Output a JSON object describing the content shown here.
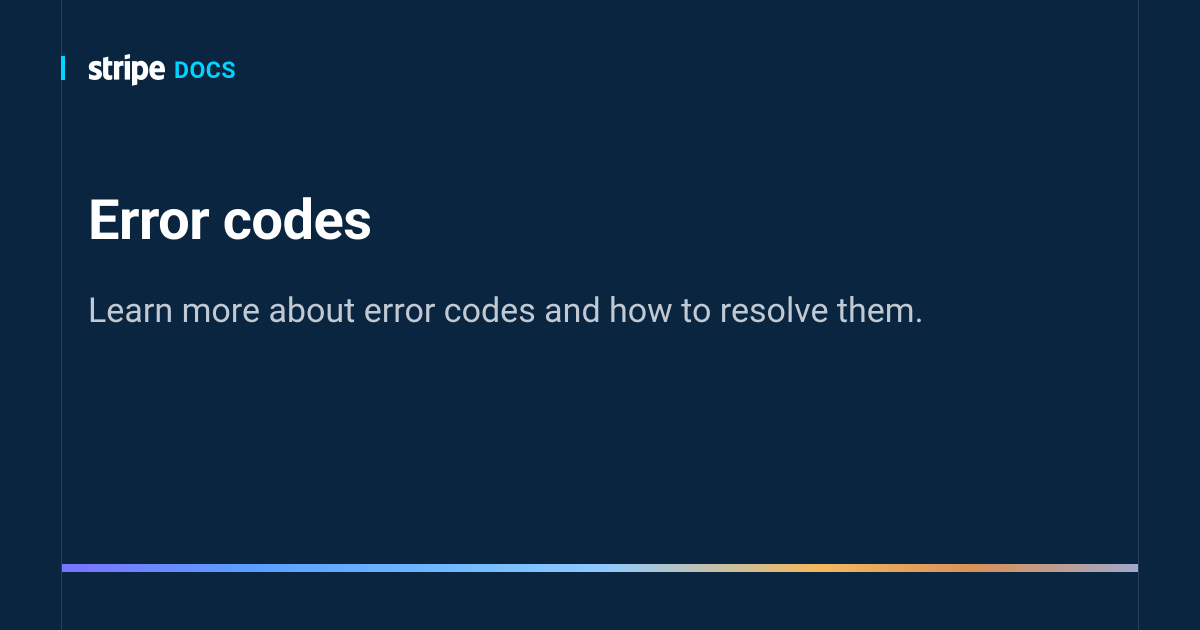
{
  "brand": {
    "name": "stripe",
    "section": "DOCS",
    "accent_color": "#00d4ff"
  },
  "page": {
    "title": "Error codes",
    "subtitle": "Learn more about error codes and how to resolve them."
  }
}
